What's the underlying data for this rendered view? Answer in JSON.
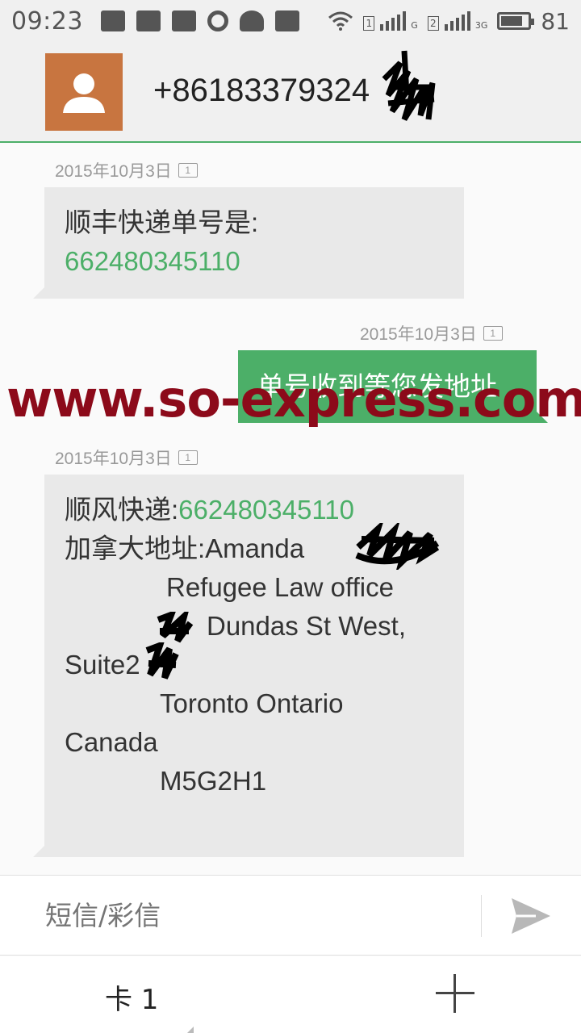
{
  "status_bar": {
    "time": "09:23",
    "sim1_label": "1",
    "sim1_net": "G",
    "sim2_label": "2",
    "sim2_net": "3G",
    "battery": "81",
    "battery_level_percent": 81
  },
  "header": {
    "contact_number": "+86183379324"
  },
  "messages": [
    {
      "direction": "incoming",
      "date": "2015年10月3日",
      "sim": "1",
      "line1": "顺丰快递单号是:",
      "tracking": "662480345110"
    },
    {
      "direction": "outgoing",
      "date": "2015年10月3日",
      "sim": "1",
      "text": "单号收到等您发地址"
    },
    {
      "direction": "incoming",
      "date": "2015年10月3日",
      "sim": "1",
      "prefix": "顺风快递:",
      "tracking": "662480345110",
      "address_label": "加拿大地址:",
      "name": "Amanda",
      "office": "Refugee Law office",
      "street": "Dundas St West,",
      "suite": "Suite2",
      "city": "Toronto Ontario",
      "country": "Canada",
      "postal": "M5G2H1"
    }
  ],
  "watermark": "www.so-express.com",
  "composer": {
    "placeholder": "短信/彩信"
  },
  "bottom_bar": {
    "sim_select": "卡 1"
  },
  "colors": {
    "accent_green": "#4caf68",
    "avatar_bg": "#c87540",
    "watermark": "#8c0a1a"
  }
}
